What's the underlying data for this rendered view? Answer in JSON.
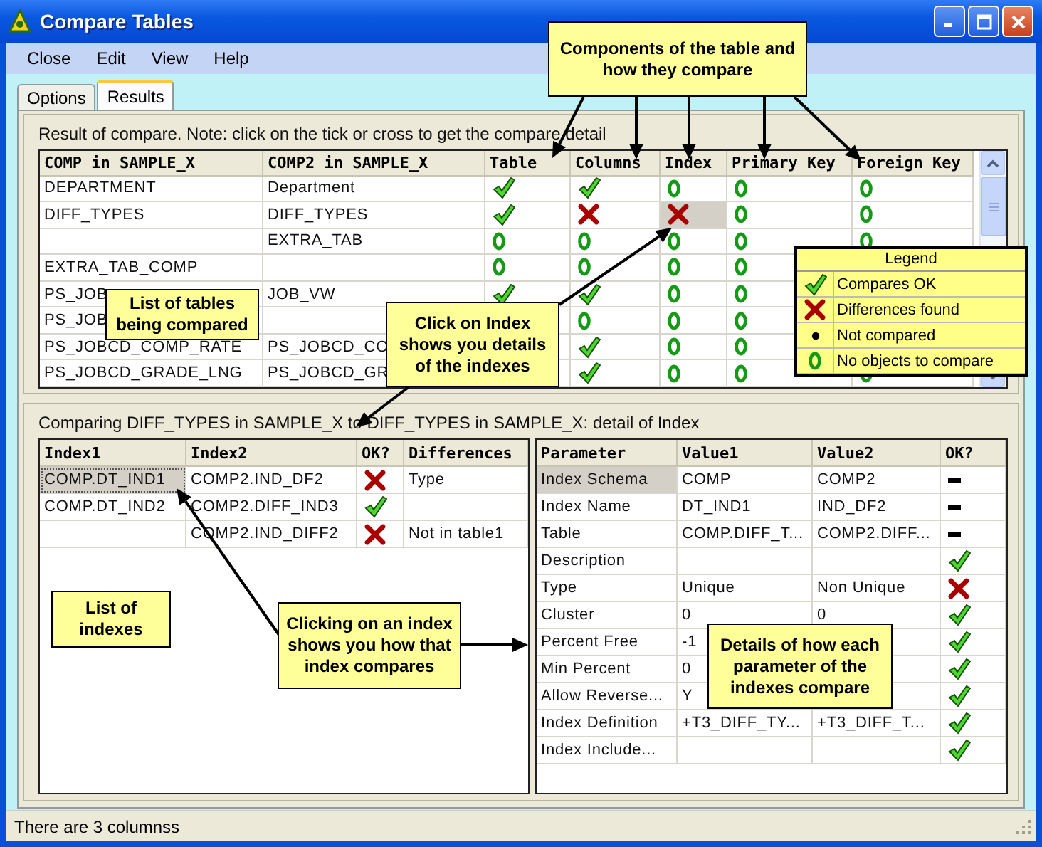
{
  "window": {
    "title": "Compare Tables"
  },
  "menu": [
    "Close",
    "Edit",
    "View",
    "Help"
  ],
  "tabs": [
    {
      "label": "Options",
      "selected": false
    },
    {
      "label": "Results",
      "selected": true
    }
  ],
  "top_section": {
    "note": "Result of compare. Note: click on the tick or cross to get the compare detail",
    "columns": [
      "COMP in SAMPLE_X",
      "COMP2 in SAMPLE_X",
      "Table",
      "Columns",
      "Index",
      "Primary Key",
      "Foreign Key"
    ],
    "rows": [
      {
        "comp1": "DEPARTMENT",
        "comp2": "Department",
        "table": {
          "kind": "check"
        },
        "columns": {
          "kind": "check"
        },
        "index": {
          "kind": "ring"
        },
        "primary_key": {
          "kind": "ring"
        },
        "foreign_key": {
          "kind": "ring"
        },
        "selected": false
      },
      {
        "comp1": "DIFF_TYPES",
        "comp2": "DIFF_TYPES",
        "table": {
          "kind": "check"
        },
        "columns": {
          "kind": "cross"
        },
        "index": {
          "kind": "cross"
        },
        "primary_key": {
          "kind": "ring"
        },
        "foreign_key": {
          "kind": "ring"
        },
        "selected": true
      },
      {
        "comp2": "EXTRA_TAB",
        "table": {
          "kind": "ring"
        },
        "columns": {
          "kind": "ring"
        },
        "index": {
          "kind": "ring"
        },
        "primary_key": {
          "kind": "ring"
        },
        "foreign_key": {
          "kind": "ring"
        },
        "selected": false
      },
      {
        "comp1": "EXTRA_TAB_COMP",
        "table": {
          "kind": "ring"
        },
        "columns": {
          "kind": "ring"
        },
        "index": {
          "kind": "ring"
        },
        "primary_key": {
          "kind": "ring"
        },
        "selected": false
      },
      {
        "comp1": "PS_JOB",
        "comp2": "JOB_VW",
        "table": {
          "kind": "check"
        },
        "columns": {
          "kind": "check"
        },
        "index": {
          "kind": "ring"
        },
        "primary_key": {
          "kind": "ring"
        },
        "selected": false
      },
      {
        "comp1": "PS_JOB",
        "columns": {
          "kind": "ring"
        },
        "index": {
          "kind": "ring"
        },
        "primary_key": {
          "kind": "ring"
        },
        "selected": false
      },
      {
        "comp1": "PS_JOBCD_COMP_RATE",
        "comp2": "PS_JOBCD_CO",
        "columns": {
          "kind": "check"
        },
        "index": {
          "kind": "ring"
        },
        "primary_key": {
          "kind": "ring"
        },
        "selected": false
      },
      {
        "comp1": "PS_JOBCD_GRADE_LNG",
        "comp2": "PS_JOBCD_GR",
        "columns": {
          "kind": "check"
        },
        "index": {
          "kind": "ring"
        },
        "primary_key": {
          "kind": "ring"
        },
        "foreign_key": {
          "kind": "ring"
        },
        "selected": false
      }
    ]
  },
  "bottom_section": {
    "note": "Comparing DIFF_TYPES in SAMPLE_X to DIFF_TYPES in SAMPLE_X: detail of Index",
    "index_table": {
      "columns": [
        "Index1",
        "Index2",
        "OK?",
        "Differences"
      ],
      "rows": [
        {
          "index1": "COMP.DT_IND1",
          "index2": "COMP2.IND_DF2",
          "ok": {
            "kind": "cross"
          },
          "differences": "Type",
          "selected": true
        },
        {
          "index1": "COMP.DT_IND2",
          "index2": "COMP2.DIFF_IND3",
          "ok": {
            "kind": "check"
          },
          "selected": false
        },
        {
          "index2": "COMP2.IND_DIFF2",
          "ok": {
            "kind": "cross"
          },
          "differences": "Not in table1",
          "selected": false
        }
      ]
    },
    "detail_table": {
      "columns": [
        "Parameter",
        "Value1",
        "Value2",
        "OK?"
      ],
      "rows": [
        {
          "parameter": "Index Schema",
          "value1": "COMP",
          "value2": "COMP2",
          "ok": {
            "kind": "dash"
          },
          "selected": true
        },
        {
          "parameter": "Index Name",
          "value1": "DT_IND1",
          "value2": "IND_DF2",
          "ok": {
            "kind": "dash"
          },
          "selected": false
        },
        {
          "parameter": "Table",
          "value1": "COMP.DIFF_T...",
          "value2": "COMP2.DIFF...",
          "ok": {
            "kind": "dash"
          },
          "selected": false
        },
        {
          "parameter": "Description",
          "ok": {
            "kind": "check"
          },
          "selected": false
        },
        {
          "parameter": "Type",
          "value1": "Unique",
          "value2": "Non Unique",
          "ok": {
            "kind": "cross"
          },
          "selected": false
        },
        {
          "parameter": "Cluster",
          "value1": "0",
          "value2": "0",
          "ok": {
            "kind": "check"
          },
          "selected": false
        },
        {
          "parameter": "Percent Free",
          "value1": "-1",
          "ok": {
            "kind": "check"
          },
          "selected": false
        },
        {
          "parameter": "Min Percent",
          "value1": "0",
          "ok": {
            "kind": "check"
          },
          "selected": false
        },
        {
          "parameter": "Allow Reverse...",
          "value1": "Y",
          "ok": {
            "kind": "check"
          },
          "selected": false
        },
        {
          "parameter": "Index Definition",
          "value1": "+T3_DIFF_TY...",
          "value2": "+T3_DIFF_T...",
          "ok": {
            "kind": "check"
          },
          "selected": false
        },
        {
          "parameter": "Index Include...",
          "ok": {
            "kind": "check"
          },
          "selected": false
        }
      ]
    }
  },
  "status_bar": "There are 3 columnss",
  "legend": {
    "title": "Legend",
    "items": [
      {
        "kind": "check",
        "label": "Compares OK"
      },
      {
        "kind": "cross",
        "label": "Differences found"
      },
      {
        "kind": "dot",
        "label": "Not compared"
      },
      {
        "kind": "ring",
        "label": "No objects to compare"
      }
    ]
  },
  "callouts": [
    {
      "text": "Components of the table and how they compare"
    },
    {
      "text": "List of tables being compared"
    },
    {
      "text": "Click on Index shows you details of the indexes"
    },
    {
      "text": "List of indexes"
    },
    {
      "text": "Clicking on an index shows you how that index compares"
    },
    {
      "text": "Details of how each parameter of the indexes compare"
    }
  ]
}
